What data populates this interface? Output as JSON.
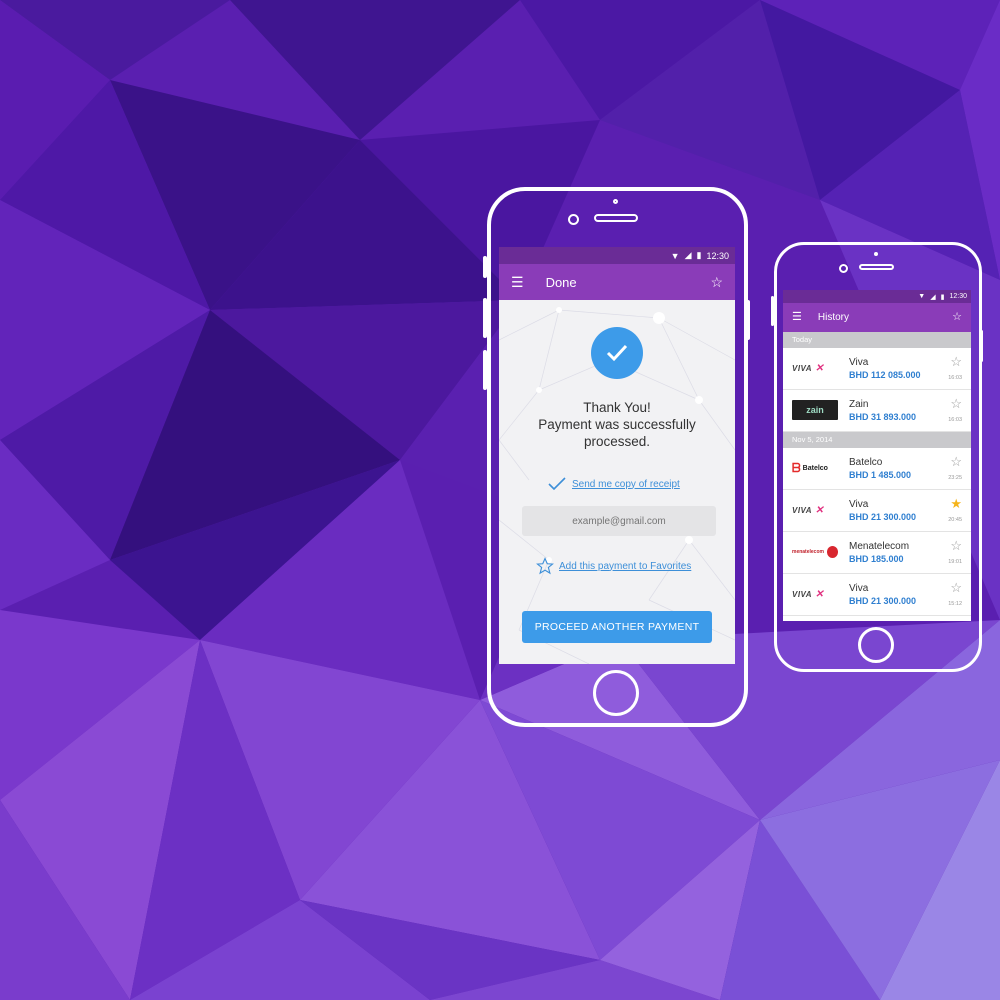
{
  "payment_screen": {
    "status_time": "12:30",
    "appbar_title": "Done",
    "thanks_line1": "Thank You!",
    "thanks_line2": "Payment was successfully",
    "thanks_line3": "processed.",
    "receipt_link": "Send me copy of receipt",
    "email_placeholder": "example@gmail.com",
    "favorites_link": "Add this payment to Favorites",
    "proceed_label": "PROCEED ANOTHER PAYMENT"
  },
  "history_screen": {
    "status_time": "12:30",
    "appbar_title": "History",
    "sections": [
      {
        "label": "Today",
        "items": [
          {
            "logo": "VIVA",
            "name": "Viva",
            "amount": "BHD 112 085.000",
            "time": "16:03",
            "favorite": false
          },
          {
            "logo": "zain",
            "name": "Zain",
            "amount": "BHD 31 893.000",
            "time": "16:03",
            "favorite": false
          }
        ]
      },
      {
        "label": "Nov 5, 2014",
        "items": [
          {
            "logo": "Batelco",
            "name": "Batelco",
            "amount": "BHD 1 485.000",
            "time": "23:25",
            "favorite": false
          },
          {
            "logo": "VIVA",
            "name": "Viva",
            "amount": "BHD 21 300.000",
            "time": "20:45",
            "favorite": true
          },
          {
            "logo": "menatelecom",
            "name": "Menatelecom",
            "amount": "BHD 185.000",
            "time": "19:01",
            "favorite": false
          },
          {
            "logo": "VIVA",
            "name": "Viva",
            "amount": "BHD 21 300.000",
            "time": "15:12",
            "favorite": false
          }
        ]
      }
    ]
  },
  "colors": {
    "accent_blue": "#3d9be9",
    "appbar_purple": "#8a3cb8",
    "statusbar_purple": "#6a2c96",
    "favorite_star": "#f5b41b"
  },
  "icons": [
    "menu-icon",
    "star-icon",
    "check-icon",
    "wifi-icon",
    "signal-icon",
    "battery-icon"
  ]
}
